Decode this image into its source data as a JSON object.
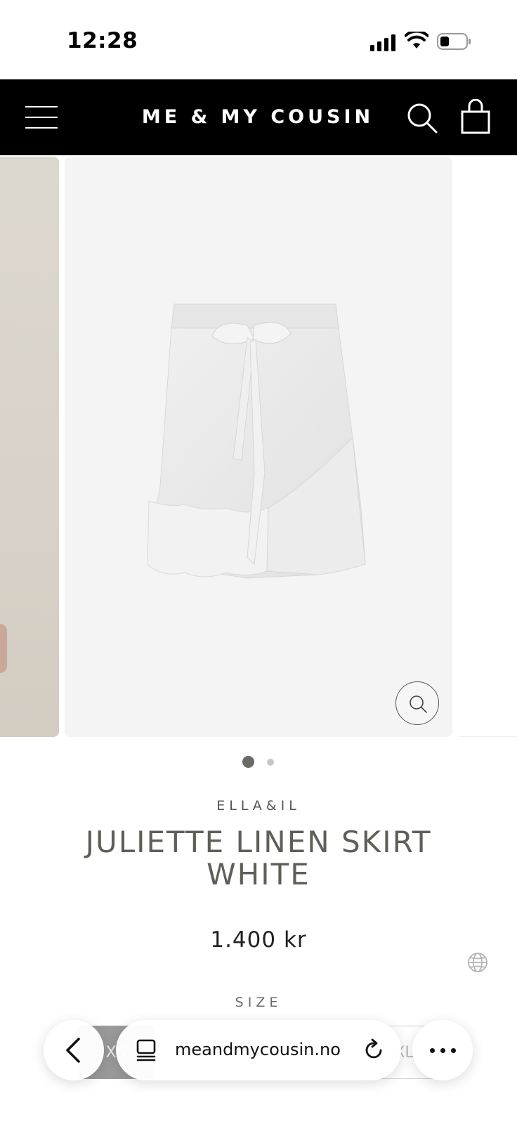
{
  "status_bar": {
    "time": "12:28",
    "icons": [
      "cellular-signal-icon",
      "wifi-icon",
      "battery-icon"
    ]
  },
  "header": {
    "logo": "ME & MY COUSIN",
    "icons": [
      "menu-icon",
      "search-icon",
      "cart-icon"
    ],
    "background": "#000000"
  },
  "gallery": {
    "slides_count": 2,
    "active_slide": 1,
    "zoom_icon": "zoom-icon"
  },
  "product": {
    "brand": "ELLA&IL",
    "title": "JULIETTE LINEN SKIRT WHITE",
    "price": "1.400 kr",
    "size_label": "SIZE",
    "sizes_visible": [
      "XS",
      "XL"
    ]
  },
  "browser": {
    "url": "meandmycousin.no",
    "icons": [
      "back-chevron-icon",
      "tabs-icon",
      "reload-icon",
      "more-icon"
    ]
  },
  "colors": {
    "title_gray": "#5f5f59",
    "header_black": "#000000",
    "image_bg": "#f4f4f4"
  }
}
